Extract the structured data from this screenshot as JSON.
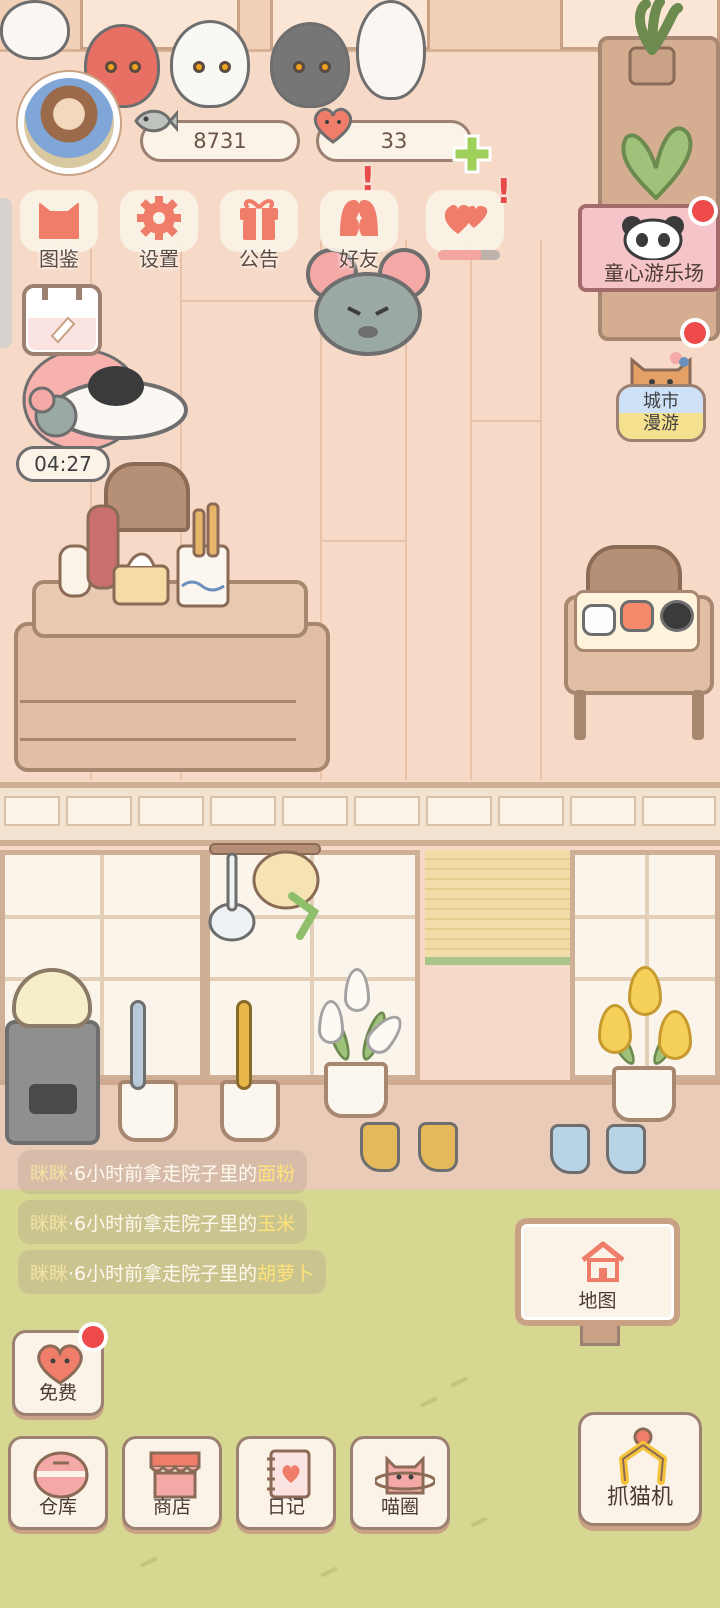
{
  "hud": {
    "fish_count": "8731",
    "heart_count": "33"
  },
  "menu": [
    {
      "label": "图鉴",
      "icon": "cat-head-icon"
    },
    {
      "label": "设置",
      "icon": "gear-icon"
    },
    {
      "label": "公告",
      "icon": "gift-icon"
    },
    {
      "label": "好友",
      "icon": "friends-icon"
    },
    {
      "label": "",
      "icon": "hearts-icon"
    }
  ],
  "timer": "04:27",
  "amusement_park": {
    "label": "童心游乐场"
  },
  "city_tour": {
    "line1": "城市",
    "line2": "漫游"
  },
  "notices": [
    {
      "who": "眯眯",
      "text": "·6小时前拿走院子里的",
      "item": "面粉"
    },
    {
      "who": "眯眯",
      "text": "·6小时前拿走院子里的",
      "item": "玉米"
    },
    {
      "who": "眯眯",
      "text": "·6小时前拿走院子里的",
      "item": "胡萝卜"
    }
  ],
  "map": {
    "label": "地图"
  },
  "free": {
    "label": "免费"
  },
  "dock": [
    {
      "label": "仓库",
      "icon": "bun-icon"
    },
    {
      "label": "商店",
      "icon": "shop-icon"
    },
    {
      "label": "日记",
      "icon": "diary-icon"
    },
    {
      "label": "喵圈",
      "icon": "planet-cat-icon"
    }
  ],
  "claw_machine": {
    "label": "抓猫机"
  },
  "colors": {
    "accent_pink": "#f07d6a",
    "badge_red": "#ee4a4a",
    "plus_green": "#9fd15a",
    "grass": "#d6d891",
    "floor": "#f6d9c6"
  }
}
